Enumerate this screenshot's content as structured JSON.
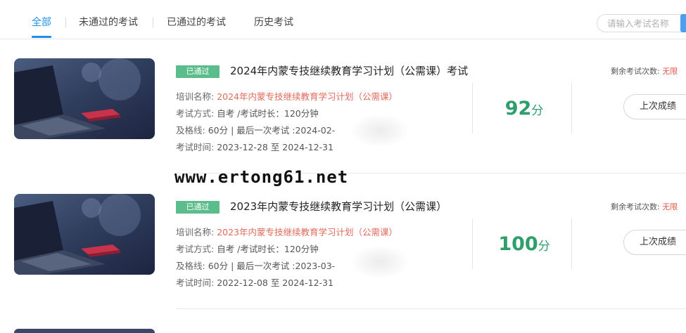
{
  "tabs": [
    {
      "label": "全部",
      "active": true
    },
    {
      "label": "未通过的考试",
      "active": false
    },
    {
      "label": "已通过的考试",
      "active": false
    },
    {
      "label": "历史考试",
      "active": false
    }
  ],
  "search": {
    "placeholder": "请输入考试名称"
  },
  "exams": [
    {
      "badge": "已通过",
      "title": "2024年内蒙专技继续教育学习计划（公需课）考试",
      "training_label": "培训名称:",
      "training_name": "2024年内蒙专技继续教育学习计划（公需课）",
      "mode_label": "考试方式:",
      "mode": "自考 /考试时长：120分钟",
      "pass_label": "及格线:",
      "pass_line": "60分 | 最后一次考试 :2024-02-",
      "time_label": "考试时间:",
      "time": "2023-12-28 至 2024-12-31",
      "score": "92",
      "score_unit": "分",
      "remaining_label": "剩余考试次数:",
      "remaining_value": "无限",
      "button": "上次成绩"
    },
    {
      "badge": "已通过",
      "title": "2023年内蒙专技继续教育学习计划（公需课）",
      "training_label": "培训名称:",
      "training_name": "2023年内蒙专技继续教育学习计划（公需课）",
      "mode_label": "考试方式:",
      "mode": "自考 /考试时长：120分钟",
      "pass_label": "及格线:",
      "pass_line": "60分 | 最后一次考试 :2023-03-",
      "time_label": "考试时间:",
      "time": "2022-12-08 至 2024-12-31",
      "score": "100",
      "score_unit": "分",
      "remaining_label": "剩余考试次数:",
      "remaining_value": "无限",
      "button": "上次成绩"
    }
  ],
  "watermark": "www.ertong61.net"
}
